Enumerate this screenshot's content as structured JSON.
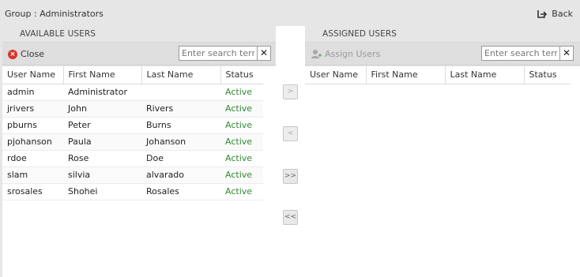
{
  "header": {
    "group_title": "Group : Administrators",
    "back_label": "Back"
  },
  "available": {
    "title": "AVAILABLE USERS",
    "close_label": "Close",
    "search_placeholder": "Enter search term",
    "columns": [
      "User Name",
      "First Name",
      "Last Name",
      "Status"
    ],
    "rows": [
      [
        "admin",
        "Administrator",
        "",
        "Active"
      ],
      [
        "jrivers",
        "John",
        "Rivers",
        "Active"
      ],
      [
        "pburns",
        "Peter",
        "Burns",
        "Active"
      ],
      [
        "pjohanson",
        "Paula",
        "Johanson",
        "Active"
      ],
      [
        "rdoe",
        "Rose",
        "Doe",
        "Active"
      ],
      [
        "slam",
        "silvia",
        "alvarado",
        "Active"
      ],
      [
        "srosales",
        "Shohei",
        "Rosales",
        "Active"
      ]
    ]
  },
  "assigned": {
    "title": "ASSIGNED USERS",
    "assign_label": "Assign Users",
    "search_placeholder": "Enter search term",
    "columns": [
      "User Name",
      "First Name",
      "Last Name",
      "Status"
    ],
    "rows": []
  },
  "move_buttons": {
    "add_one": ">",
    "remove_one": "<",
    "add_all": ">>",
    "remove_all": "<<"
  },
  "colors": {
    "status_active": "#2f8a2f",
    "close_icon": "#d9342b"
  }
}
